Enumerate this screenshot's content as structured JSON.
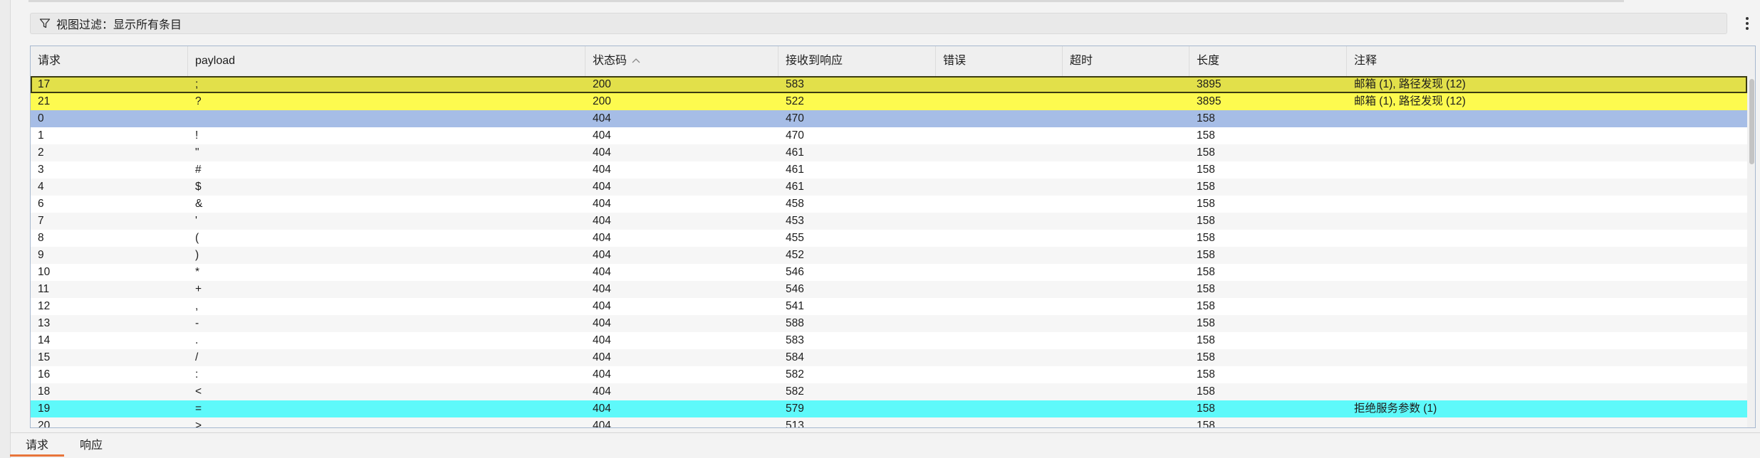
{
  "filter": {
    "label": "视图过滤：显示所有条目",
    "icon": "filter-icon"
  },
  "table": {
    "columns": [
      "请求",
      "payload",
      "状态码",
      "接收到响应",
      "错误",
      "超时",
      "长度",
      "注释"
    ],
    "sort_column": "状态码",
    "sort_icon": "sort-ascending-icon",
    "rows": [
      {
        "id": "17",
        "payload": ";",
        "status": "200",
        "received": "583",
        "error": "",
        "timeout": "",
        "length": "3895",
        "comment": "邮箱 (1), 路径发现 (12)",
        "highlight": "selected"
      },
      {
        "id": "21",
        "payload": "?",
        "status": "200",
        "received": "522",
        "error": "",
        "timeout": "",
        "length": "3895",
        "comment": "邮箱 (1), 路径发现 (12)",
        "highlight": "yellow"
      },
      {
        "id": "0",
        "payload": "",
        "status": "404",
        "received": "470",
        "error": "",
        "timeout": "",
        "length": "158",
        "comment": "",
        "highlight": "blue"
      },
      {
        "id": "1",
        "payload": "!",
        "status": "404",
        "received": "470",
        "error": "",
        "timeout": "",
        "length": "158",
        "comment": "",
        "highlight": ""
      },
      {
        "id": "2",
        "payload": "\"",
        "status": "404",
        "received": "461",
        "error": "",
        "timeout": "",
        "length": "158",
        "comment": "",
        "highlight": ""
      },
      {
        "id": "3",
        "payload": "#",
        "status": "404",
        "received": "461",
        "error": "",
        "timeout": "",
        "length": "158",
        "comment": "",
        "highlight": ""
      },
      {
        "id": "4",
        "payload": "$",
        "status": "404",
        "received": "461",
        "error": "",
        "timeout": "",
        "length": "158",
        "comment": "",
        "highlight": ""
      },
      {
        "id": "6",
        "payload": "&",
        "status": "404",
        "received": "458",
        "error": "",
        "timeout": "",
        "length": "158",
        "comment": "",
        "highlight": ""
      },
      {
        "id": "7",
        "payload": "'",
        "status": "404",
        "received": "453",
        "error": "",
        "timeout": "",
        "length": "158",
        "comment": "",
        "highlight": ""
      },
      {
        "id": "8",
        "payload": "(",
        "status": "404",
        "received": "455",
        "error": "",
        "timeout": "",
        "length": "158",
        "comment": "",
        "highlight": ""
      },
      {
        "id": "9",
        "payload": ")",
        "status": "404",
        "received": "452",
        "error": "",
        "timeout": "",
        "length": "158",
        "comment": "",
        "highlight": ""
      },
      {
        "id": "10",
        "payload": "*",
        "status": "404",
        "received": "546",
        "error": "",
        "timeout": "",
        "length": "158",
        "comment": "",
        "highlight": ""
      },
      {
        "id": "11",
        "payload": "+",
        "status": "404",
        "received": "546",
        "error": "",
        "timeout": "",
        "length": "158",
        "comment": "",
        "highlight": ""
      },
      {
        "id": "12",
        "payload": ",",
        "status": "404",
        "received": "541",
        "error": "",
        "timeout": "",
        "length": "158",
        "comment": "",
        "highlight": ""
      },
      {
        "id": "13",
        "payload": "-",
        "status": "404",
        "received": "588",
        "error": "",
        "timeout": "",
        "length": "158",
        "comment": "",
        "highlight": ""
      },
      {
        "id": "14",
        "payload": ".",
        "status": "404",
        "received": "583",
        "error": "",
        "timeout": "",
        "length": "158",
        "comment": "",
        "highlight": ""
      },
      {
        "id": "15",
        "payload": "/",
        "status": "404",
        "received": "584",
        "error": "",
        "timeout": "",
        "length": "158",
        "comment": "",
        "highlight": ""
      },
      {
        "id": "16",
        "payload": ":",
        "status": "404",
        "received": "582",
        "error": "",
        "timeout": "",
        "length": "158",
        "comment": "",
        "highlight": ""
      },
      {
        "id": "18",
        "payload": "<",
        "status": "404",
        "received": "582",
        "error": "",
        "timeout": "",
        "length": "158",
        "comment": "",
        "highlight": ""
      },
      {
        "id": "19",
        "payload": "=",
        "status": "404",
        "received": "579",
        "error": "",
        "timeout": "",
        "length": "158",
        "comment": "拒绝服务参数 (1)",
        "highlight": "cyan"
      },
      {
        "id": "20",
        "payload": ">",
        "status": "404",
        "received": "513",
        "error": "",
        "timeout": "",
        "length": "158",
        "comment": "",
        "highlight": ""
      }
    ]
  },
  "bottom_tabs": [
    {
      "label": "请求",
      "active": true
    },
    {
      "label": "响应",
      "active": false
    }
  ],
  "colors": {
    "selected_row": "#e2e04a",
    "yellow_row": "#fdfa4f",
    "blue_row": "#a6bde6",
    "cyan_row": "#5ef9fa",
    "active_tab_underline": "#e8753a"
  }
}
